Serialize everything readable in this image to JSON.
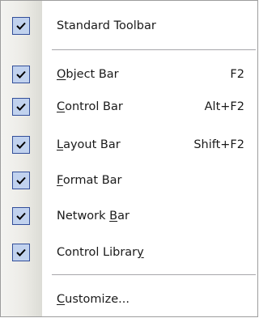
{
  "menu": {
    "items": [
      {
        "label": "Standard Toolbar",
        "mn_pre": "",
        "mn_char": "",
        "mn_post": "",
        "shortcut": "",
        "checked": true
      },
      {
        "label": "",
        "mn_pre": "",
        "mn_char": "O",
        "mn_post": "bject Bar",
        "shortcut": "F2",
        "checked": true
      },
      {
        "label": "",
        "mn_pre": "",
        "mn_char": "C",
        "mn_post": "ontrol Bar",
        "shortcut": "Alt+F2",
        "checked": true
      },
      {
        "label": "",
        "mn_pre": "",
        "mn_char": "L",
        "mn_post": "ayout Bar",
        "shortcut": "Shift+F2",
        "checked": true
      },
      {
        "label": "",
        "mn_pre": "",
        "mn_char": "F",
        "mn_post": "ormat Bar",
        "shortcut": "",
        "checked": true
      },
      {
        "label": "",
        "mn_pre": "Network ",
        "mn_char": "B",
        "mn_post": "ar",
        "shortcut": "",
        "checked": true
      },
      {
        "label": "",
        "mn_pre": "Control Librar",
        "mn_char": "y",
        "mn_post": "",
        "shortcut": "",
        "checked": true
      },
      {
        "label": "",
        "mn_pre": "",
        "mn_char": "C",
        "mn_post": "ustomize...",
        "shortcut": "",
        "checked": false
      }
    ]
  },
  "icons": {
    "checkmark": "check-icon"
  },
  "colors": {
    "check_fill": "#c1d2ee",
    "check_border": "#334f9a",
    "separator": "#a7a6aa"
  }
}
